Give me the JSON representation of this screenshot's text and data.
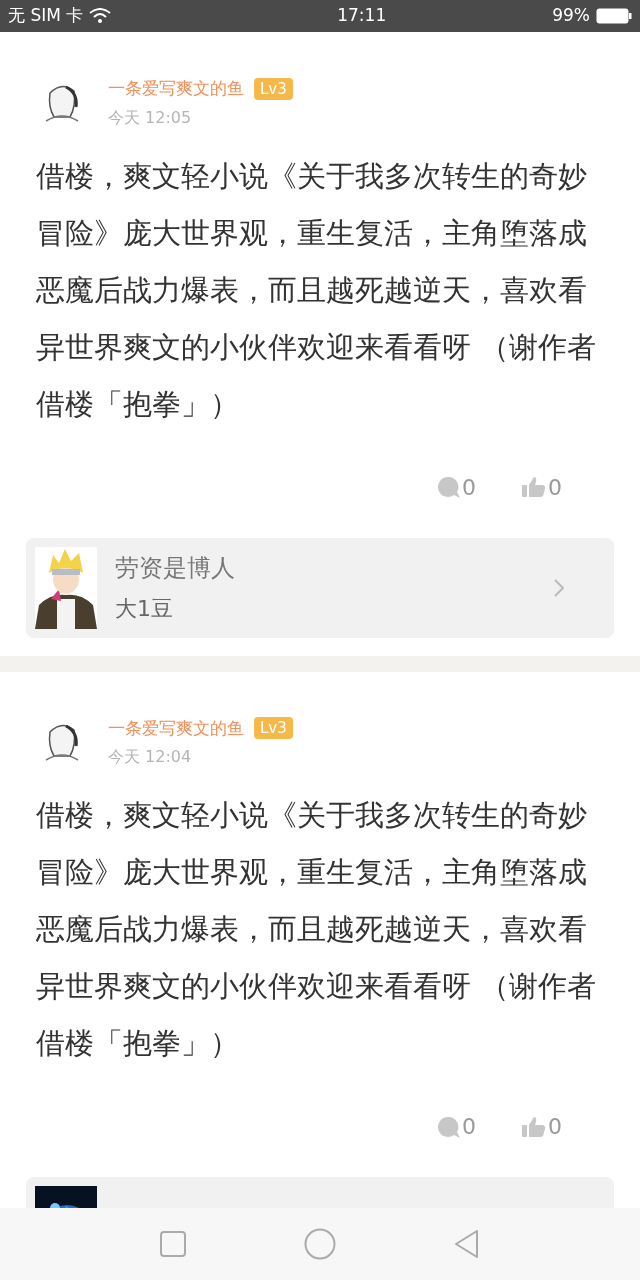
{
  "status_bar": {
    "carrier": "无 SIM 卡",
    "time": "17:11",
    "battery": "99%"
  },
  "posts": [
    {
      "author": "一条爱写爽文的鱼",
      "level": "Lv3",
      "time": "今天 12:05",
      "body": "借楼，爽文轻小说《关于我多次转生的奇妙冒险》庞大世界观，重生复活，主角堕落成恶魔后战力爆表，而且越死越逆天，喜欢看异世界爽文的小伙伴欢迎来看看呀 （谢作者借楼「抱拳」）",
      "comments": "0",
      "likes": "0",
      "book": {
        "title": "劳资是博人",
        "subtitle": "大1豆"
      }
    },
    {
      "author": "一条爱写爽文的鱼",
      "level": "Lv3",
      "time": "今天 12:04",
      "body": "借楼，爽文轻小说《关于我多次转生的奇妙冒险》庞大世界观，重生复活，主角堕落成恶魔后战力爆表，而且越死越逆天，喜欢看异世界爽文的小伙伴欢迎来看看呀 （谢作者借楼「抱拳」）",
      "comments": "0",
      "likes": "0"
    }
  ]
}
